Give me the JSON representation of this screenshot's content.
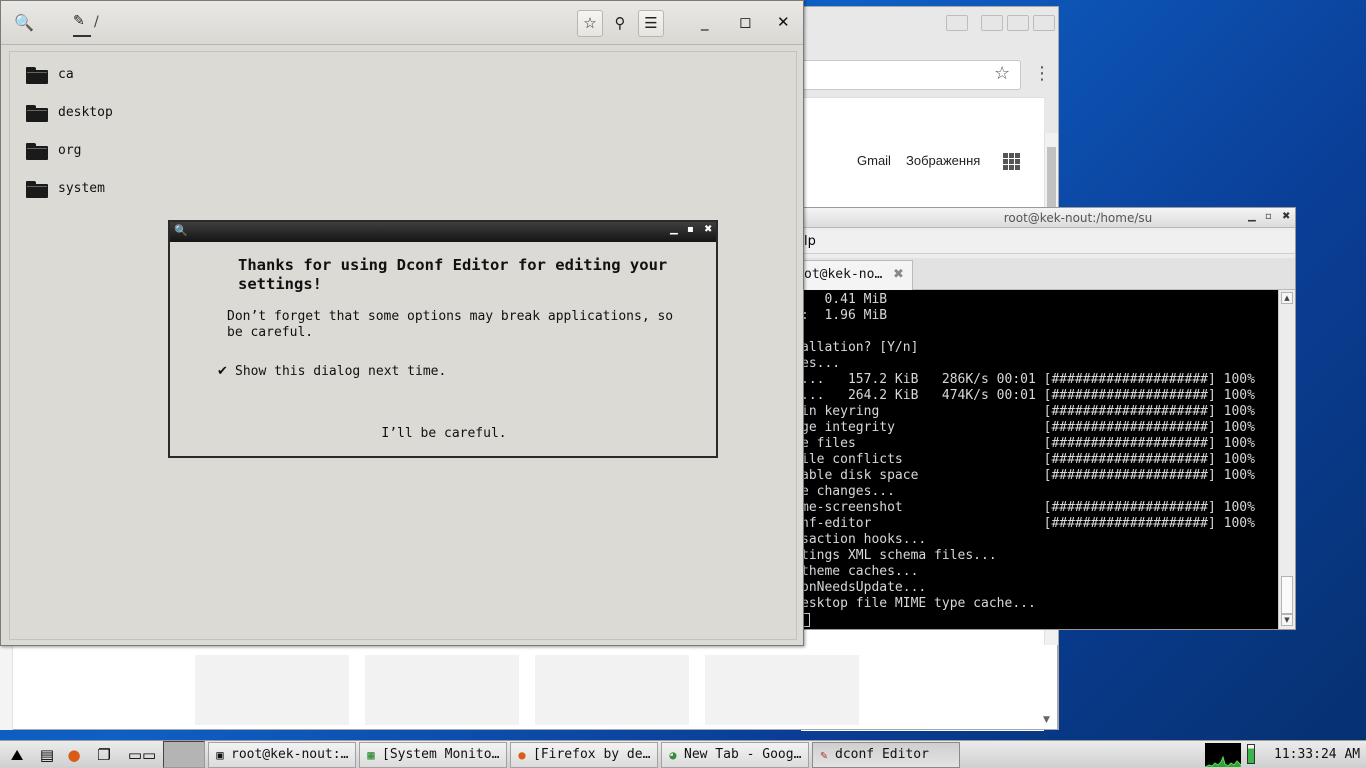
{
  "browser": {
    "links": {
      "gmail": "Gmail",
      "images": "Зображення"
    }
  },
  "terminal": {
    "title": "root@kek-nout:/home/su",
    "menu_fragment": "lp",
    "tab_label": "ot@kek-no…",
    "lines": [
      "   0.41 MiB",
      ":  1.96 MiB",
      "",
      "allation? [Y/n]",
      "es...",
      "...   157.2 KiB   286K/s 00:01 [####################] 100%",
      "...   264.2 KiB   474K/s 00:01 [####################] 100%",
      "in keyring                     [####################] 100%",
      "ge integrity                   [####################] 100%",
      "e files                        [####################] 100%",
      "ile conflicts                  [####################] 100%",
      "able disk space                [####################] 100%",
      "e changes...",
      "me-screenshot                  [####################] 100%",
      "nf-editor                      [####################] 100%",
      "saction hooks...",
      "tings XML schema files...",
      "theme caches...",
      "onNeedsUpdate...",
      "esktop file MIME type cache..."
    ]
  },
  "dconf": {
    "path_separator": "/",
    "folders": [
      "ca",
      "desktop",
      "org",
      "system"
    ]
  },
  "dialog": {
    "heading": "Thanks for using Dconf Editor for editing your settings!",
    "message": "Don’t forget that some options may break applications, so be careful.",
    "checkbox_label": "Show this dialog next time.",
    "checkbox_checked": true,
    "confirm_button": "I’ll be careful."
  },
  "taskbar": {
    "tasks": [
      {
        "label": "root@kek-nout:…",
        "icon": "terminal-icon"
      },
      {
        "label": "[System Monito…",
        "icon": "system-monitor-icon"
      },
      {
        "label": "[Firefox by de…",
        "icon": "firefox-icon"
      },
      {
        "label": "New Tab - Goog…",
        "icon": "chrome-icon"
      },
      {
        "label": "dconf Editor",
        "icon": "dconf-icon"
      }
    ],
    "clock": "11:33:24 AM"
  },
  "colors": {
    "desktop": "#0a4fb0",
    "terminal_bg": "#000000",
    "window_bg": "#dcdad5"
  }
}
